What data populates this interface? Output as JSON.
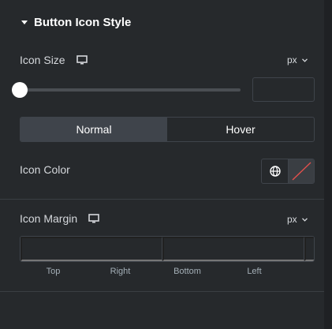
{
  "section": {
    "title": "Button Icon Style"
  },
  "icon_size": {
    "label": "Icon Size",
    "unit": "px",
    "value": ""
  },
  "state_tabs": [
    {
      "label": "Normal",
      "active": true
    },
    {
      "label": "Hover",
      "active": false
    }
  ],
  "icon_color": {
    "label": "Icon Color"
  },
  "icon_margin": {
    "label": "Icon Margin",
    "unit": "px",
    "sides": [
      "Top",
      "Right",
      "Bottom",
      "Left"
    ]
  },
  "colors": {
    "panel_bg": "#26292c",
    "border": "#3f444b",
    "text": "#d5d8dc",
    "empty_swatch_slash": "#e2504c"
  }
}
